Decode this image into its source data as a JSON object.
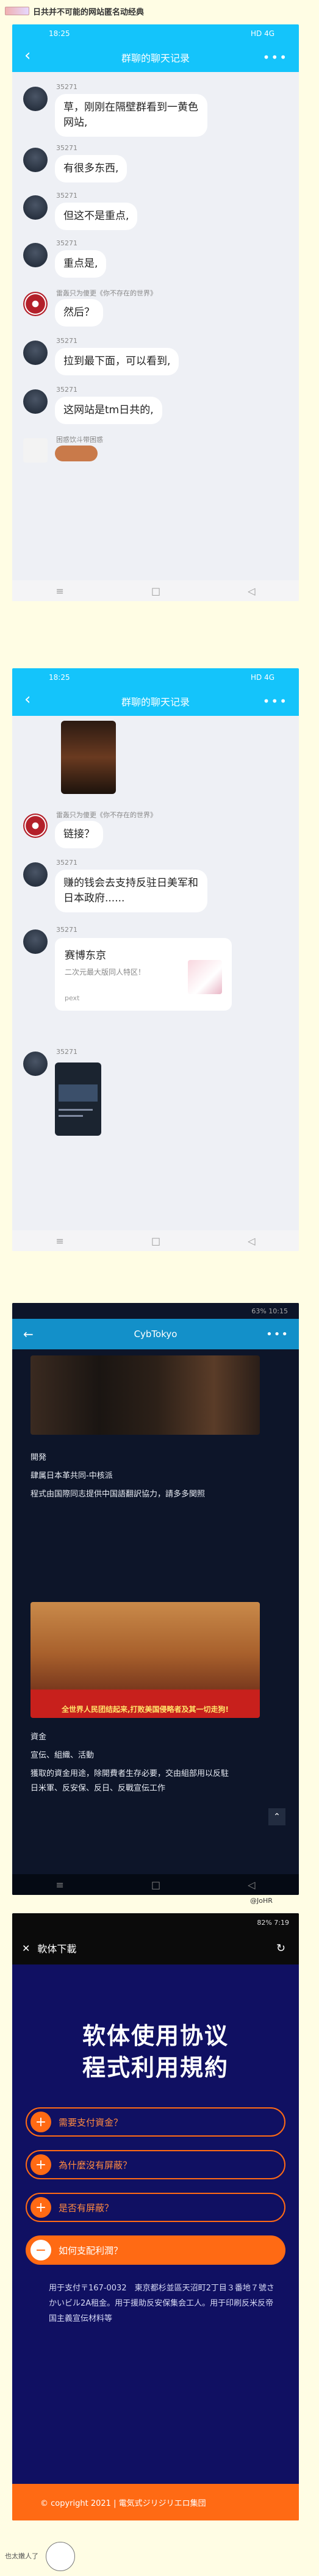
{
  "post": {
    "title": "日共并不可能的网站匿名动经典"
  },
  "screen1": {
    "status_time": "18:25",
    "status_right": "HD 4G",
    "title": "群聊的聊天记录",
    "messages": [
      {
        "nick": "35271",
        "text": "草，刚刚在隔壁群看到一黄色网站,"
      },
      {
        "nick": "35271",
        "text": "有很多东西,"
      },
      {
        "nick": "35271",
        "text": "但这不是重点,"
      },
      {
        "nick": "35271",
        "text": "重点是,"
      },
      {
        "nick": "雷轰只为傻更《你不存在的世界》",
        "text": "然后？"
      },
      {
        "nick": "35271",
        "text": "拉到最下面，可以看到,"
      },
      {
        "nick": "35271",
        "text": "这网站是tm日共的,"
      },
      {
        "nick": "困惑饮斗带困惑",
        "text": ""
      }
    ]
  },
  "screen2": {
    "status_time": "18:25",
    "status_right": "HD 4G",
    "title": "群聊的聊天记录",
    "messages": [
      {
        "nick": "雷轰只为傻更《你不存在的世界》",
        "text": "链接？"
      },
      {
        "nick": "35271",
        "text": "赚的钱会去支持反驻日美军和日本政府......"
      },
      {
        "nick": "35271",
        "text": ""
      },
      {
        "nick": "35271",
        "text": ""
      }
    ],
    "card": {
      "title": "赛博东京",
      "subtitle": "二次元最大版同人特区！",
      "source": "pext"
    }
  },
  "screen3": {
    "status_right": "63% 10:15",
    "title": "CybTokyo",
    "sections": [
      {
        "heading": "開発",
        "line1": "肆属日本革共同-中核派",
        "body": "程式由国際同志提供中国語翻訳協力，請多多関照"
      },
      {
        "heading": "資金",
        "line1": "宣伝、組織、活動",
        "body": "獲取的資金用途，除開費者生存必要，交由組部用以反駐日米軍、反安保、反日、反戰宣伝工作"
      }
    ],
    "poster_text": "全世界人民团结起来,打败美国侵略者及其一切走狗!",
    "watermark": "@JoHR"
  },
  "screen4": {
    "status_right": "82% 7:19",
    "nav_title": "軟体下載",
    "heading_cn": "软体使用协议",
    "heading_jp": "程式利用規約",
    "items": [
      {
        "label": "需要支付資金？"
      },
      {
        "label": "為什麼沒有屏蔽？"
      },
      {
        "label": "是否有屏蔽？"
      },
      {
        "label": "如何支配利潤？"
      }
    ],
    "answer": "用于支付〒167-0032　東京都杉並區天沼町2丁目３番地７號さかいビル2A租金。用于援助反安保集会工人。用于印刷反米反帝国主義宣伝材料等",
    "footer": "© copyright 2021 | 電気式ジリジリエロ集団"
  },
  "bottom_tag": "也太嫩人了"
}
